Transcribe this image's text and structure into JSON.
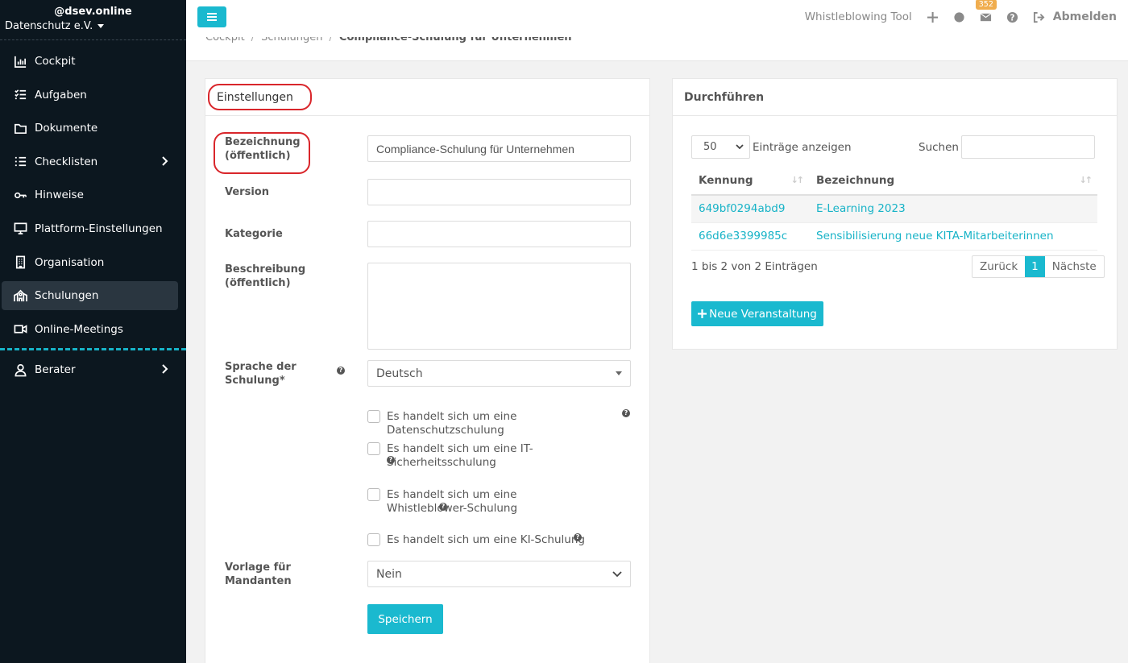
{
  "sidebar": {
    "site": "@dsev.online",
    "org": "Datenschutz e.V.",
    "items": [
      {
        "label": "Cockpit",
        "icon": "chart-icon"
      },
      {
        "label": "Aufgaben",
        "icon": "tasks-icon"
      },
      {
        "label": "Dokumente",
        "icon": "folder-icon"
      },
      {
        "label": "Checklisten",
        "icon": "list-icon"
      },
      {
        "label": "Hinweise",
        "icon": "key-icon"
      },
      {
        "label": "Plattform-Einstellungen",
        "icon": "monitor-icon"
      },
      {
        "label": "Organisation",
        "icon": "building-icon"
      },
      {
        "label": "Schulungen",
        "icon": "school-icon"
      },
      {
        "label": "Online-Meetings",
        "icon": "video-icon"
      }
    ],
    "footer_item": {
      "label": "Berater",
      "icon": "user-icon"
    }
  },
  "topbar": {
    "whistleblowing": "Whistleblowing Tool",
    "badge_count": "352",
    "logout": "Abmelden"
  },
  "breadcrumb": {
    "items": [
      "Cockpit",
      "Schulungen"
    ],
    "current": "Compliance-Schulung für Unternehmen"
  },
  "settings": {
    "title": "Einstellungen",
    "name_label": "Bezeichnung (öffentlich)",
    "name_value": "Compliance-Schulung für Unternehmen",
    "version_label": "Version",
    "version_value": "",
    "category_label": "Kategorie",
    "category_value": "",
    "description_label": "Beschreibung (öffentlich)",
    "description_value": "",
    "language_label": "Sprache der Schulung*",
    "language_value": "Deutsch",
    "checkboxes": [
      "Es handelt sich um eine Datenschutzschulung",
      "Es handelt sich um eine IT-Sicherheitsschulung",
      "Es handelt sich um eine Whistleblower-Schulung",
      "Es handelt sich um eine KI-Schulung"
    ],
    "template_label": "Vorlage für Mandanten",
    "template_value": "Nein",
    "save": "Speichern"
  },
  "execute": {
    "title": "Durchführen",
    "page_length": "50",
    "length_text": "Einträge anzeigen",
    "search_label": "Suchen",
    "columns": [
      "Kennung",
      "Bezeichnung"
    ],
    "rows": [
      [
        "649bf0294abd9",
        "E-Learning 2023"
      ],
      [
        "66d6e3399985c",
        "Sensibilisierung neue KITA-Mitarbeiterinnen"
      ]
    ],
    "info": "1 bis 2 von 2 Einträgen",
    "prev": "Zurück",
    "page": "1",
    "next": "Nächste",
    "new_button": "Neue Veranstaltung"
  },
  "colors": {
    "accent": "#1ab9cf",
    "sidebar": "#0c171f",
    "highlight": "#d9262b"
  }
}
